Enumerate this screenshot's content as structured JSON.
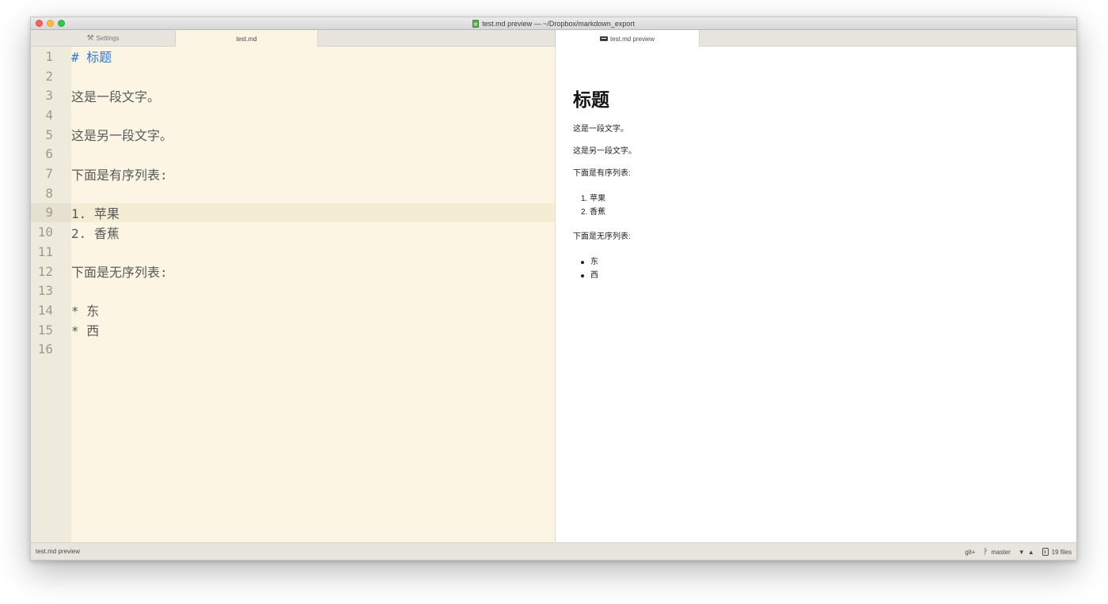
{
  "window": {
    "title": "test.md preview — ~/Dropbox/markdown_export"
  },
  "tabs_left": [
    {
      "label": "Settings",
      "icon": "tools-icon"
    },
    {
      "label": "test.md"
    }
  ],
  "tabs_right": [
    {
      "label": "test.md preview",
      "icon": "preview-icon"
    }
  ],
  "editor": {
    "current_line": 9,
    "lines": [
      {
        "num": "1",
        "text": "# 标题"
      },
      {
        "num": "2",
        "text": ""
      },
      {
        "num": "3",
        "text": "这是一段文字。"
      },
      {
        "num": "4",
        "text": ""
      },
      {
        "num": "5",
        "text": "这是另一段文字。"
      },
      {
        "num": "6",
        "text": ""
      },
      {
        "num": "7",
        "text": "下面是有序列表:"
      },
      {
        "num": "8",
        "text": ""
      },
      {
        "num": "9",
        "text": "1. 苹果"
      },
      {
        "num": "10",
        "text": "2. 香蕉"
      },
      {
        "num": "11",
        "text": ""
      },
      {
        "num": "12",
        "text": "下面是无序列表:"
      },
      {
        "num": "13",
        "text": ""
      },
      {
        "num": "14",
        "text": "* 东"
      },
      {
        "num": "15",
        "text": "* 西"
      },
      {
        "num": "16",
        "text": ""
      }
    ]
  },
  "preview": {
    "heading": "标题",
    "para1": "这是一段文字。",
    "para2": "这是另一段文字。",
    "ordered_intro": "下面是有序列表:",
    "ordered": [
      "1. 苹果",
      "2. 香蕉"
    ],
    "unordered_intro": "下面是无序列表:",
    "unordered": [
      "东",
      "西"
    ]
  },
  "status": {
    "left": "test.md preview",
    "git": "git+",
    "branch": "master",
    "files": "19 files"
  },
  "colors": {
    "editor_bg": "#fdf5e3",
    "heading_blue": "#2f7ad0"
  }
}
